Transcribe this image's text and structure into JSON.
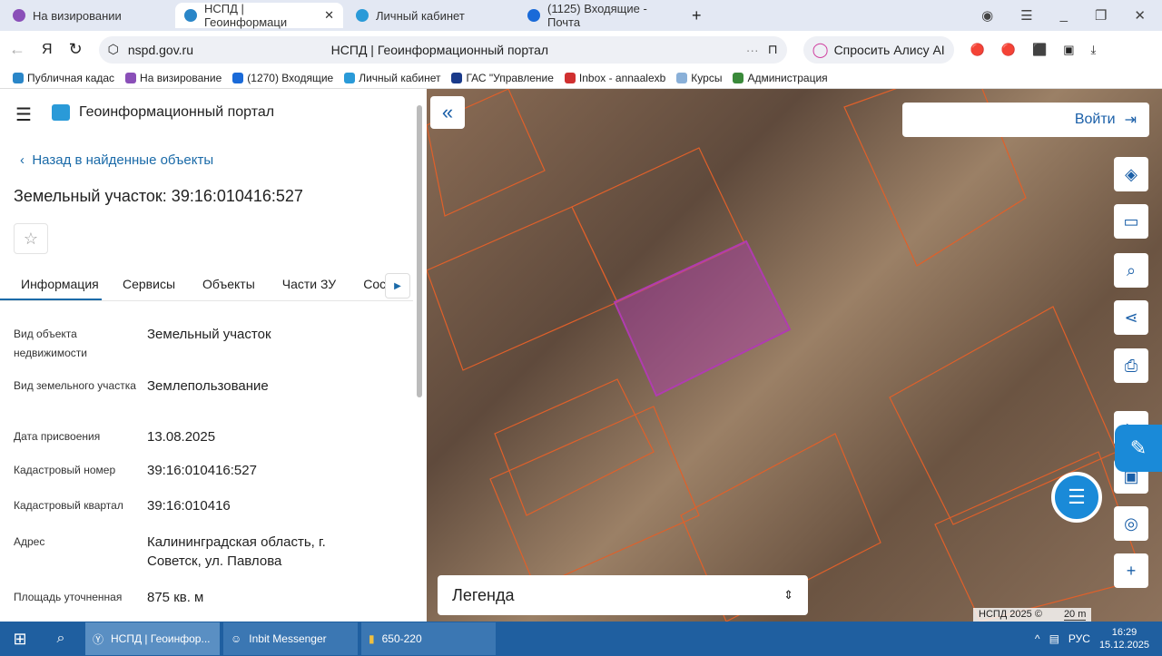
{
  "browser": {
    "tabs": [
      {
        "label": "На визировании",
        "color": "#8a4fb8"
      },
      {
        "label": "НСПД | Геоинформаци",
        "color": "#2a86c8",
        "active": true
      },
      {
        "label": "Личный кабинет",
        "color": "#2a9ad8"
      },
      {
        "label": "(1125) Входящие - Почта",
        "color": "#1a6ad8"
      }
    ],
    "url": "nspd.gov.ru",
    "page_title": "НСПД | Геоинформационный портал",
    "alice": "Спросить Алису AI",
    "bookmarks": [
      "Публичная кадас",
      "На визирование",
      "(1270) Входящие",
      "Личный кабинет",
      "ГАС \"Управление",
      "Inbox - annaalexb",
      "Курсы",
      "Администрация"
    ]
  },
  "panel": {
    "app_title": "Геоинформационный портал",
    "back": "Назад в найденные объекты",
    "title": "Земельный участок: 39:16:010416:527",
    "tabs": [
      "Информация",
      "Сервисы",
      "Объекты",
      "Части ЗУ",
      "Сост"
    ],
    "fields": [
      {
        "label": "Вид объекта недвижимости",
        "value": "Земельный участок"
      },
      {
        "label": "Вид земельного участка",
        "value": "Землепользование"
      },
      {
        "label": "Дата присвоения",
        "value": "13.08.2025"
      },
      {
        "label": "Кадастровый номер",
        "value": "39:16:010416:527"
      },
      {
        "label": "Кадастровый квартал",
        "value": "39:16:010416"
      },
      {
        "label": "Адрес",
        "value": "Калининградская область, г. Советск, ул. Павлова"
      },
      {
        "label": "Площадь уточненная",
        "value": "875 кв. м"
      }
    ]
  },
  "map": {
    "login": "Войти",
    "legend": "Легенда",
    "copyright": "НСПД 2025 ©",
    "scale": "20 m",
    "parcel_color": "#b03cb0",
    "boundary_color": "#e0602a"
  },
  "taskbar": {
    "items": [
      "НСПД | Геоинфор...",
      "Inbit Messenger",
      "650-220"
    ],
    "lang": "РУС",
    "time": "16:29",
    "date": "15.12.2025"
  }
}
